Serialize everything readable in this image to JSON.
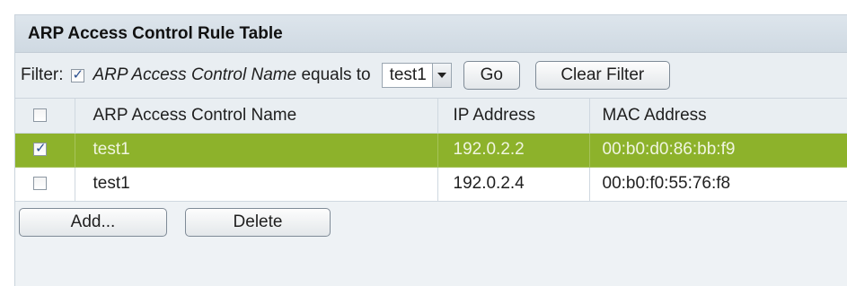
{
  "table_title": "ARP Access Control Rule Table",
  "filter": {
    "label": "Filter:",
    "checked": true,
    "field_name": "ARP Access Control Name",
    "operator": "equals to",
    "selected_value": "test1",
    "go_label": "Go",
    "clear_label": "Clear Filter"
  },
  "columns": [
    "ARP Access Control Name",
    "IP Address",
    "MAC Address"
  ],
  "rows": [
    {
      "selected": true,
      "name": "test1",
      "ip": "192.0.2.2",
      "mac": "00:b0:d0:86:bb:f9"
    },
    {
      "selected": false,
      "name": "test1",
      "ip": "192.0.2.4",
      "mac": "00:b0:f0:55:76:f8"
    }
  ],
  "actions": {
    "add_label": "Add...",
    "delete_label": "Delete"
  },
  "colors": {
    "selected_row": "#8db22b",
    "header_bg": "#d6dfe7"
  }
}
